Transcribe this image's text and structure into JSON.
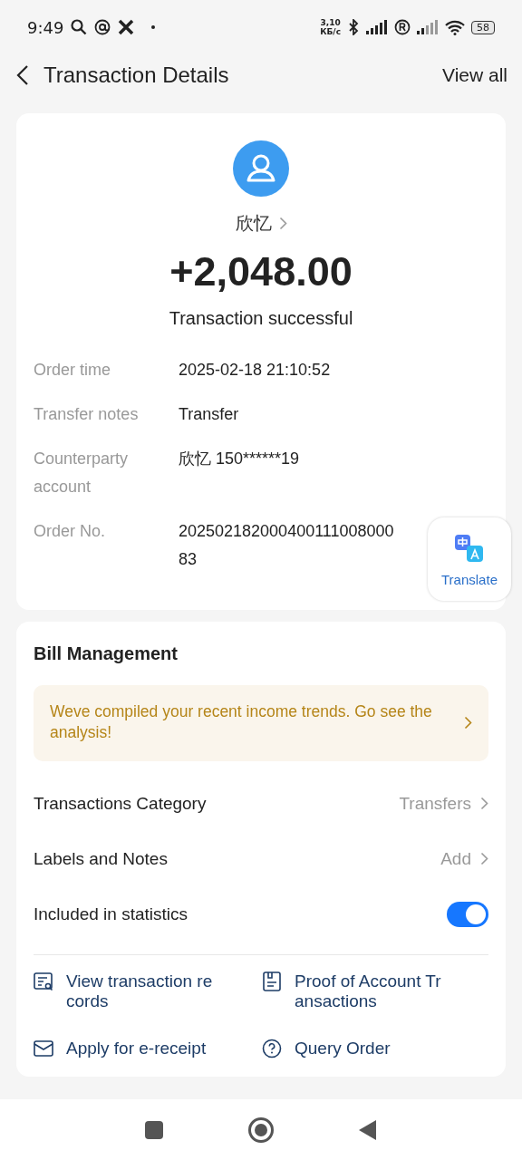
{
  "status_bar": {
    "time": "9:49",
    "speed": "3,10",
    "speed_unit": "КБ/с",
    "battery": "58"
  },
  "header": {
    "title": "Transaction Details",
    "action": "View all"
  },
  "summary": {
    "name": "欣忆",
    "amount": "+2,048.00",
    "status": "Transaction successful"
  },
  "details": [
    {
      "label": "Order time",
      "value_lines": [
        "2025-02-18 21:10:52"
      ]
    },
    {
      "label": "Transfer notes",
      "value_lines": [
        "Transfer"
      ]
    },
    {
      "label": "Counterparty account",
      "value_lines": [
        "欣忆 150******19"
      ]
    },
    {
      "label": "Order No.",
      "value_lines": [
        "202502182000400111008000",
        "83"
      ]
    }
  ],
  "translate_button": {
    "label": "Translate"
  },
  "bill_management": {
    "title": "Bill Management",
    "banner": "Weve compiled your recent income trends. Go see the analysis!",
    "rows": [
      {
        "kind": "link",
        "label": "Transactions Category",
        "value": "Transfers"
      },
      {
        "kind": "link",
        "label": "Labels and Notes",
        "value": "Add"
      },
      {
        "kind": "toggle",
        "label": "Included in statistics",
        "on": true
      }
    ],
    "actions": [
      {
        "kind": "records",
        "lines": [
          "View transaction re",
          "cords"
        ]
      },
      {
        "kind": "proof",
        "lines": [
          "Proof of Account Tr",
          "ansactions"
        ]
      },
      {
        "kind": "receipt",
        "lines": [
          "Apply for e-receipt"
        ]
      },
      {
        "kind": "query",
        "lines": [
          "Query Order"
        ]
      }
    ]
  }
}
